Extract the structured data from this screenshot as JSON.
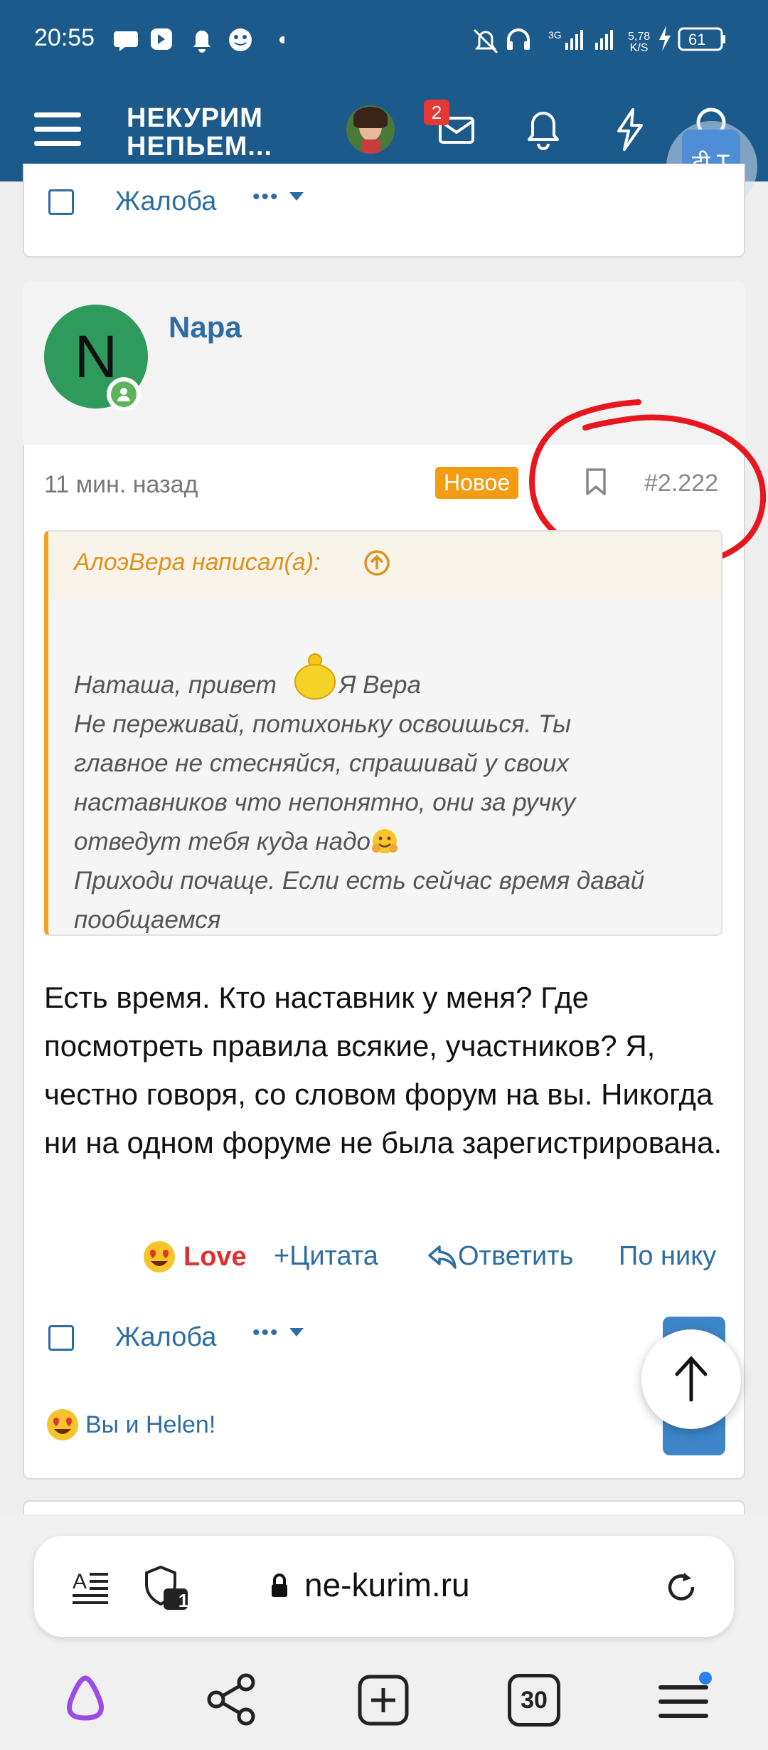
{
  "status_bar": {
    "time": "20:55",
    "network_speed": "5,78",
    "network_unit": "K/S",
    "net_type": "3G",
    "battery": "61"
  },
  "header": {
    "logo_line1": "НЕКУРИМ",
    "logo_line2": "НЕПЬЕМ...",
    "inbox_badge": "2",
    "translate_icon": "दी T"
  },
  "prev_post": {
    "report_label": "Жалоба",
    "more_label": "•••"
  },
  "post": {
    "author": "Napa",
    "avatar_letter": "N",
    "time_ago": "11 мин. назад",
    "new_badge": "Новое",
    "post_number": "#2.222",
    "quote": {
      "author_line": "АлоэВера написал(а):",
      "line1_a": "Наташа, привет",
      "line1_b": "Я Вера",
      "line2": "Не переживай, потихоньку освоишься. Ты",
      "line3": "главное не стесняйся, спрашивай у своих",
      "line4": "наставников что непонятно, они за ручку",
      "line5": "отведут тебя куда надо",
      "line6": "Приходи почаще. Если есть сейчас время давай",
      "line7": "пообщаемся"
    },
    "message": "Есть время. Кто наставник у меня? Где посмотреть правила всякие, участников? Я, честно говоря, со словом форум на вы. Никогда ни на одном форуме не была зарегистрирована.",
    "actions": {
      "love": "Love",
      "quote": "Цитата",
      "reply": "Ответить",
      "by_nick": "По нику"
    },
    "report_label": "Жалоба",
    "more_label": "•••",
    "reactions_text": "Вы и Helen!"
  },
  "browser": {
    "url": "ne-kurim.ru",
    "tabs_count": "30",
    "tracker_count": "1"
  },
  "colors": {
    "header_bg": "#1c5a8c",
    "link": "#2e6da3",
    "new_badge": "#f39c12",
    "quote_accent": "#f0a31e",
    "love": "#e03131",
    "annotation": "#e8161d"
  }
}
